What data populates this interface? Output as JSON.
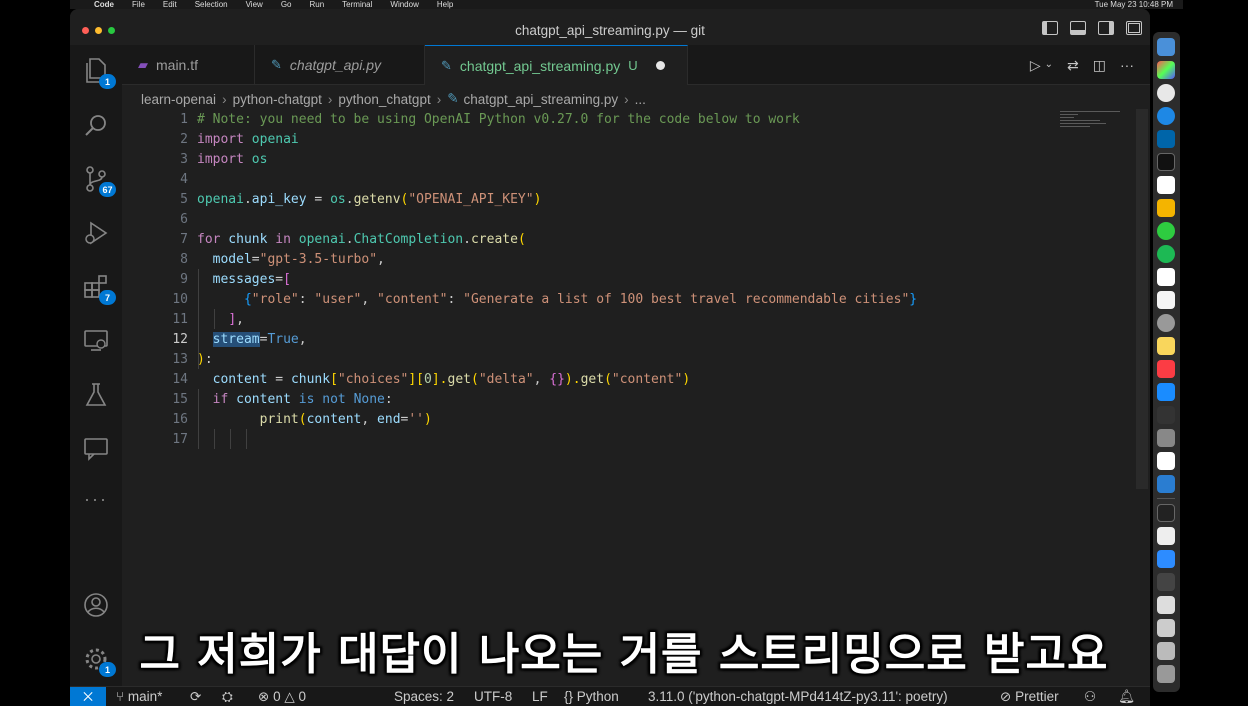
{
  "menubar": {
    "app": "Code",
    "items": [
      "File",
      "Edit",
      "Selection",
      "View",
      "Go",
      "Run",
      "Terminal",
      "Window",
      "Help"
    ],
    "datetime": "Tue May 23  10:48 PM"
  },
  "window": {
    "title": "chatgpt_api_streaming.py — git"
  },
  "activity_bar": {
    "explorer_badge": "1",
    "scm_badge": "67",
    "extensions_badge": "7",
    "settings_badge": "1"
  },
  "tabs": [
    {
      "label": "main.tf",
      "icon": "terraform-icon"
    },
    {
      "label": "chatgpt_api.py",
      "icon": "python-icon"
    },
    {
      "label": "chatgpt_api_streaming.py",
      "icon": "python-icon",
      "status": "U"
    }
  ],
  "breadcrumb": [
    "learn-openai",
    "python-chatgpt",
    "python_chatgpt",
    "chatgpt_api_streaming.py",
    "..."
  ],
  "editor": {
    "current_line": "12",
    "line_numbers": [
      "1",
      "2",
      "3",
      "4",
      "5",
      "6",
      "7",
      "8",
      "9",
      "10",
      "11",
      "12",
      "13",
      "14",
      "15",
      "16",
      "17"
    ],
    "lines": {
      "l1": "# Note: you need to be using OpenAI Python v0.27.0 for the code below to work",
      "l2_kw": "import",
      "l2_mod": "openai",
      "l3_kw": "import",
      "l3_mod": "os",
      "l5_a": "openai",
      "l5_b": ".",
      "l5_c": "api_key",
      "l5_d": " = ",
      "l5_e": "os",
      "l5_f": ".",
      "l5_g": "getenv",
      "l5_h": "(",
      "l5_i": "\"OPENAI_API_KEY\"",
      "l5_j": ")",
      "l7_a": "for",
      "l7_b": " chunk ",
      "l7_c": "in",
      "l7_d": " openai",
      "l7_e": ".",
      "l7_f": "ChatCompletion",
      "l7_g": ".",
      "l7_h": "create",
      "l7_i": "(",
      "l8_a": "model",
      "l8_b": "=",
      "l8_c": "\"gpt-3.5-turbo\"",
      "l8_d": ",",
      "l9_a": "messages",
      "l9_b": "=",
      "l9_c": "[",
      "l10_a": "{",
      "l10_b": "\"role\"",
      "l10_c": ": ",
      "l10_d": "\"user\"",
      "l10_e": ", ",
      "l10_f": "\"content\"",
      "l10_g": ": ",
      "l10_h": "\"Generate a list of 100 best travel recommendable cities\"",
      "l10_i": "}",
      "l11_a": "]",
      "l11_b": ",",
      "l12_a": "stream",
      "l12_b": "=",
      "l12_c": "True",
      "l12_d": ",",
      "l13_a": ")",
      "l13_b": ":",
      "l14_a": "content",
      "l14_b": " = ",
      "l14_c": "chunk",
      "l14_d": "[",
      "l14_e": "\"choices\"",
      "l14_f": "][",
      "l14_g": "0",
      "l14_h": "].",
      "l14_i": "get",
      "l14_j": "(",
      "l14_k": "\"delta\"",
      "l14_l": ", ",
      "l14_m": "{}",
      "l14_n": ").",
      "l14_o": "get",
      "l14_p": "(",
      "l14_q": "\"content\"",
      "l14_r": ")",
      "l15_a": "if",
      "l15_b": " content ",
      "l15_c": "is",
      "l15_d": " ",
      "l15_e": "not",
      "l15_f": " ",
      "l15_g": "None",
      "l15_h": ":",
      "l16_a": "print",
      "l16_b": "(",
      "l16_c": "content",
      "l16_d": ", ",
      "l16_e": "end",
      "l16_f": "=",
      "l16_g": "''",
      "l16_h": ")"
    }
  },
  "statusbar": {
    "branch": "main*",
    "errors": "0",
    "warnings": "0",
    "spaces": "Spaces: 2",
    "encoding": "UTF-8",
    "eol": "LF",
    "language": "Python",
    "interpreter": "3.11.0 ('python-chatgpt-MPd414tZ-py3.11': poetry)",
    "formatter": "Prettier"
  },
  "caption": "그 저희가 대답이 나오는 거를 스트리밍으로 받고요",
  "colors": {
    "accent": "#0078d4",
    "background": "#1f1f1f",
    "sidebar": "#181818"
  }
}
